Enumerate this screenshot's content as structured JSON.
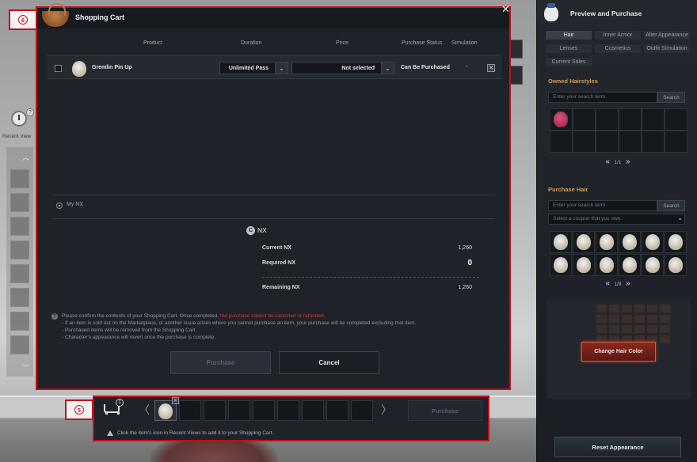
{
  "callouts": {
    "cart_dialog": "6",
    "cart_bar": "5"
  },
  "recent_views": {
    "label": "Recent View",
    "help": "?"
  },
  "cart": {
    "title": "Shopping Cart",
    "close": "✕",
    "columns": {
      "product": "Product",
      "duration": "Duration",
      "price": "Price",
      "status": "Purchase Status",
      "simulation": "Simulation"
    },
    "items": [
      {
        "name": "Gremlin Pin Up",
        "duration": "Unlimited Pass",
        "price": "Not selected",
        "status": "Can Be Purchased",
        "simulation": "-",
        "remove": "✕"
      }
    ],
    "payment": {
      "option": "My NX",
      "currency_icon": "C",
      "currency": "NX"
    },
    "nx": {
      "current_label": "Current NX",
      "current_value": "1,260",
      "required_label": "Required NX",
      "required_value": "0",
      "remaining_label": "Remaining NX",
      "remaining_value": "1,260"
    },
    "notice": {
      "icon": "?",
      "line1_prefix": "Please confirm the contents of your Shopping Cart. Once completed, ",
      "line1_warning": "the purchase cannot be canceled or refunded.",
      "line2": "- If an item is sold out on the Marketplace, or another issue arises where you cannot purchase an item, your purchase will be completed excluding that item.",
      "line3": "- Purchased items will be removed from the Shopping Cart.",
      "line4": "- Character's appearance will revert once the purchase is complete."
    },
    "buttons": {
      "purchase": "Purchase",
      "cancel": "Cancel"
    }
  },
  "cart_bar": {
    "count": "1",
    "prev": "〈",
    "next": "〉",
    "slot_remove": "✕",
    "purchase": "Purchase",
    "hint": "Click the item's icon in Recent Views to add it to your Shopping Cart."
  },
  "preview": {
    "title": "Preview and Purchase",
    "tabs": [
      "Hair",
      "Inner Armor",
      "Alter Appearance",
      "Lenses",
      "Cosmetics",
      "Outfit Simulation",
      "Current Sales"
    ],
    "active_tab": "Hair",
    "owned": {
      "title": "Owned Hairstyles",
      "search_placeholder": "Enter your search term.",
      "search_button": "Search",
      "page": "1/1",
      "prev": "«",
      "next": "»"
    },
    "purchase_hair": {
      "title": "Purchase Hair",
      "search_placeholder": "Enter your search term.",
      "search_button": "Search",
      "coupon_placeholder": "Select a coupon that you own.",
      "page": "1/8",
      "prev": "«",
      "next": "»"
    },
    "change_color": "Change Hair Color",
    "reset": "Reset Appearance"
  },
  "colors": {
    "accent_red": "#c0101a",
    "warning": "#d2362f",
    "section_title": "#d29a55"
  }
}
